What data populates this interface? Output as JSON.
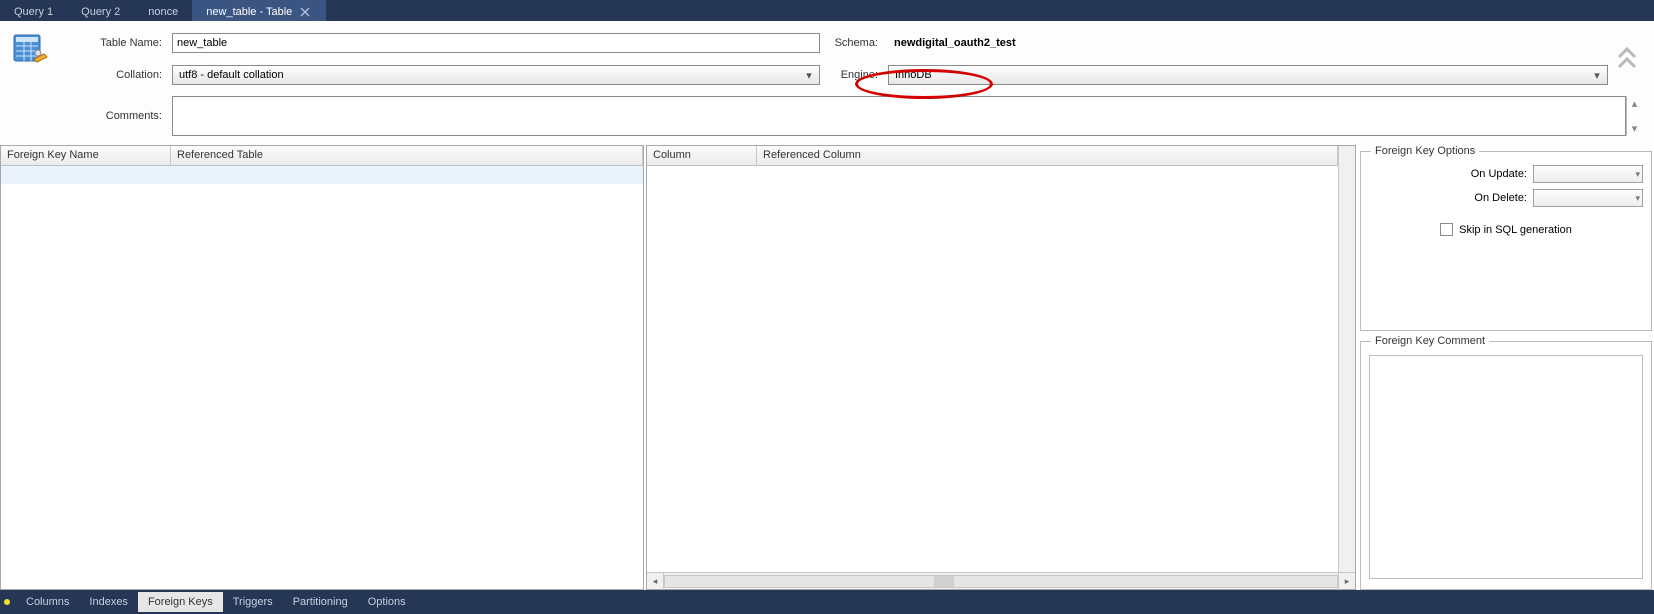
{
  "tabs": {
    "items": [
      {
        "label": "Query 1"
      },
      {
        "label": "Query 2"
      },
      {
        "label": "nonce"
      },
      {
        "label": "new_table - Table"
      }
    ],
    "activeIndex": 3
  },
  "form": {
    "tableNameLabel": "Table Name:",
    "tableNameValue": "new_table",
    "schemaLabel": "Schema:",
    "schemaValue": "newdigital_oauth2_test",
    "collationLabel": "Collation:",
    "collationValue": "utf8 - default collation",
    "engineLabel": "Engine:",
    "engineValue": "InnoDB",
    "commentsLabel": "Comments:",
    "commentsValue": ""
  },
  "gridLeft": {
    "headers": {
      "fkName": "Foreign Key Name",
      "refTable": "Referenced Table"
    }
  },
  "gridCenter": {
    "headers": {
      "column": "Column",
      "refColumn": "Referenced Column"
    }
  },
  "fkOptions": {
    "legend": "Foreign Key Options",
    "onUpdateLabel": "On Update:",
    "onUpdateValue": "",
    "onDeleteLabel": "On Delete:",
    "onDeleteValue": "",
    "skipLabel": "Skip in SQL generation"
  },
  "fkComment": {
    "legend": "Foreign Key Comment",
    "value": ""
  },
  "bottomTabs": {
    "items": [
      {
        "label": "Columns"
      },
      {
        "label": "Indexes"
      },
      {
        "label": "Foreign Keys"
      },
      {
        "label": "Triggers"
      },
      {
        "label": "Partitioning"
      },
      {
        "label": "Options"
      }
    ],
    "activeIndex": 2
  }
}
